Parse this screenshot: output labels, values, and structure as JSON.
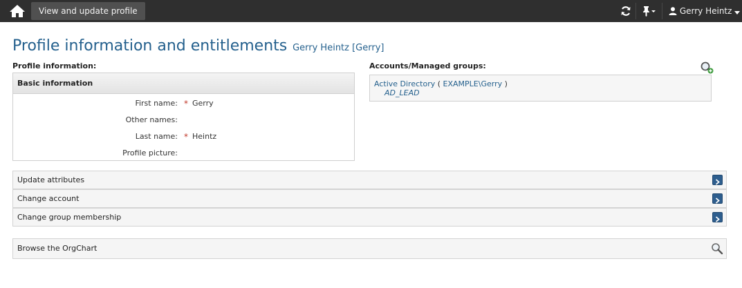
{
  "topbar": {
    "tab_label": "View and update profile",
    "user_name": "Gerry Heintz"
  },
  "title": {
    "main": "Profile information and entitlements",
    "subject": "Gerry Heintz [Gerry]"
  },
  "profile": {
    "section_label": "Profile information:",
    "box_title": "Basic information",
    "fields": [
      {
        "label": "First name:",
        "required": "*",
        "value": "Gerry"
      },
      {
        "label": "Other names:",
        "required": "",
        "value": ""
      },
      {
        "label": "Last name:",
        "required": "*",
        "value": "Heintz"
      },
      {
        "label": "Profile picture:",
        "required": "",
        "value": ""
      }
    ]
  },
  "accounts": {
    "section_label": "Accounts/Managed groups:",
    "system": "Active Directory",
    "account_prefix": "(",
    "account": "EXAMPLE\\Gerry",
    "account_suffix": ")",
    "group": "AD_LEAD"
  },
  "actions": [
    {
      "label": "Update attributes"
    },
    {
      "label": "Change account"
    },
    {
      "label": "Change group membership"
    }
  ],
  "orgchart": {
    "label": "Browse the OrgChart"
  },
  "colors": {
    "topbar": "#2f2f2f",
    "title": "#24608d",
    "required": "#c0392b",
    "go_button": "#2e5e8e"
  }
}
